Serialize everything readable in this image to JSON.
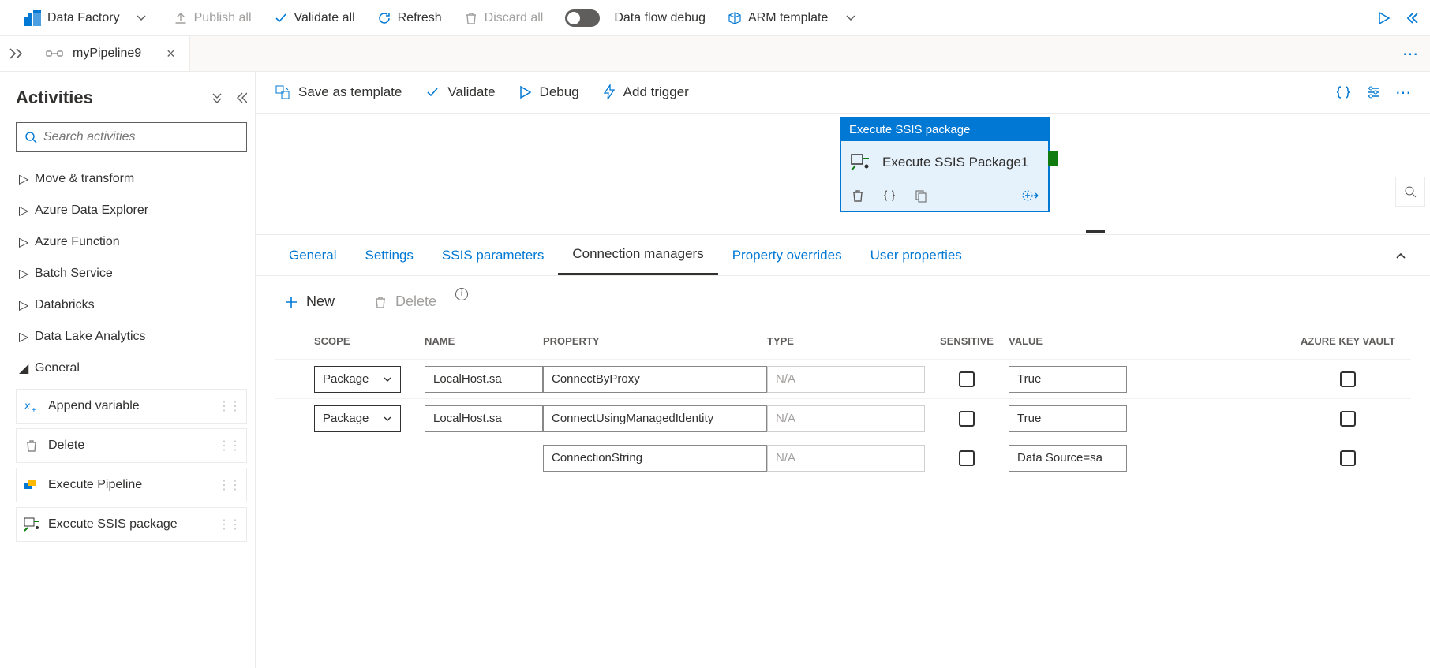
{
  "toolbar": {
    "brand": "Data Factory",
    "publish": "Publish all",
    "validate": "Validate all",
    "refresh": "Refresh",
    "discard": "Discard all",
    "dataflow": "Data flow debug",
    "arm": "ARM template"
  },
  "tab": {
    "name": "myPipeline9"
  },
  "sidebar": {
    "title": "Activities",
    "search_placeholder": "Search activities",
    "categories": [
      "Move & transform",
      "Azure Data Explorer",
      "Azure Function",
      "Batch Service",
      "Databricks",
      "Data Lake Analytics",
      "General"
    ],
    "general_items": [
      "Append variable",
      "Delete",
      "Execute Pipeline",
      "Execute SSIS package"
    ]
  },
  "content_toolbar": {
    "save_tpl": "Save as template",
    "validate": "Validate",
    "debug": "Debug",
    "add_trigger": "Add trigger"
  },
  "node": {
    "header": "Execute SSIS package",
    "title": "Execute SSIS Package1"
  },
  "detail_tabs": [
    "General",
    "Settings",
    "SSIS parameters",
    "Connection managers",
    "Property overrides",
    "User properties"
  ],
  "detail_active_index": 3,
  "detail_toolbar": {
    "new": "New",
    "delete": "Delete"
  },
  "table": {
    "headers": {
      "scope": "SCOPE",
      "name": "NAME",
      "property": "PROPERTY",
      "type": "TYPE",
      "sensitive": "SENSITIVE",
      "value": "VALUE",
      "akv": "AZURE KEY VAULT"
    },
    "rows": [
      {
        "scope": "Package",
        "name": "LocalHost.sa",
        "property": "ConnectByProxy",
        "type": "N/A",
        "value": "True"
      },
      {
        "scope": "Package",
        "name": "LocalHost.sa",
        "property": "ConnectUsingManagedIdentity",
        "type": "N/A",
        "value": "True"
      },
      {
        "scope": "",
        "name": "",
        "property": "ConnectionString",
        "type": "N/A",
        "value": "Data Source=sa"
      }
    ]
  }
}
